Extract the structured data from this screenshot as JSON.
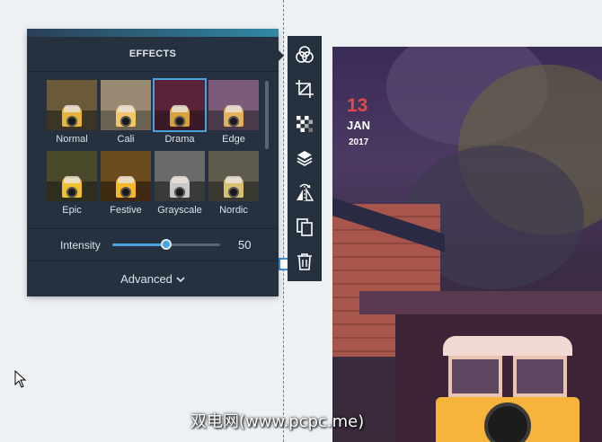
{
  "effects_panel": {
    "title": "EFFECTS",
    "filters": [
      {
        "label": "Normal",
        "tint": "#6b5a3a",
        "ground": "#3b3526",
        "bus": "#e8b43a",
        "selected": false
      },
      {
        "label": "Cali",
        "tint": "#9a8a72",
        "ground": "#6b6352",
        "bus": "#f1c667",
        "selected": false
      },
      {
        "label": "Drama",
        "tint": "#5a2238",
        "ground": "#3a1a26",
        "bus": "#d7a03a",
        "selected": true
      },
      {
        "label": "Edge",
        "tint": "#7b5a7a",
        "ground": "#4a3a4a",
        "bus": "#e2b35a",
        "selected": false
      },
      {
        "label": "Epic",
        "tint": "#4a4a2a",
        "ground": "#2e2e1e",
        "bus": "#f0c030",
        "selected": false
      },
      {
        "label": "Festive",
        "tint": "#6a4a1a",
        "ground": "#3e2b12",
        "bus": "#f6b82a",
        "selected": false
      },
      {
        "label": "Grayscale",
        "tint": "#6a6a6a",
        "ground": "#3a3a3a",
        "bus": "#c9c9c9",
        "selected": false
      },
      {
        "label": "Nordic",
        "tint": "#5e5a4c",
        "ground": "#3a3a33",
        "bus": "#d9c070",
        "selected": false
      }
    ],
    "intensity": {
      "label": "Intensity",
      "value": 50,
      "value_text": "50",
      "max": 100
    },
    "advanced_label": "Advanced"
  },
  "toolbar": {
    "tools": [
      "filters-icon",
      "crop-icon",
      "transparency-icon",
      "layers-icon",
      "flip-icon",
      "duplicate-icon",
      "delete-icon"
    ]
  },
  "photo": {
    "day": "13",
    "month": "JAN",
    "year": "2017"
  },
  "colors": {
    "accent": "#4aa3df",
    "panel": "#263140",
    "date_red": "#e34a4a"
  },
  "watermark": "双电网(www.pcpc.me)"
}
